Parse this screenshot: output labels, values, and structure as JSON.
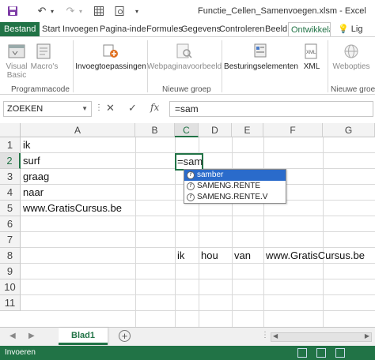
{
  "window": {
    "title": "Functie_Cellen_Samenvoegen.xlsm - Excel"
  },
  "tabs": [
    "Bestand",
    "Start",
    "Invoegen",
    "Pagina-inde",
    "Formules",
    "Gegevens",
    "Controleren",
    "Beeld",
    "Ontwikkelaa",
    "Vertel wat u wilt doen"
  ],
  "tell_me_label": "Lig",
  "ribbon": {
    "visual_basic": "Visual Basic",
    "macros": "Macro's",
    "invoegtoepassingen": "Invoegtoepassingen",
    "webpaginavoorbeeld": "Webpaginavoorbeeld",
    "besturingselementen": "Besturingselementen",
    "xml": "XML",
    "webopties": "Webopties",
    "group_programmacode": "Programmacode",
    "group_nieuwe_groep": "Nieuwe groep",
    "group_nieuwe_groep_2": "Nieuwe groep"
  },
  "formula_bar": {
    "name_box": "ZOEKEN",
    "cancel_symbol": "✕",
    "enter_symbol": "✓",
    "fx_symbol": "fx",
    "formula": "=sam"
  },
  "columns": [
    "A",
    "B",
    "C",
    "D",
    "E",
    "F",
    "G"
  ],
  "selected_column": "C",
  "rows": [
    "1",
    "2",
    "3",
    "4",
    "5",
    "6",
    "7",
    "8",
    "9",
    "10",
    "11"
  ],
  "selected_row": "2",
  "cells": {
    "A1": "ik",
    "A2": "surf",
    "A3": "graag",
    "A4": "naar",
    "A5": "www.GratisCursus.be",
    "C2": "=sam",
    "C8": "ik",
    "D8": "hou",
    "E8": "van",
    "F8": "www.GratisCursus.be"
  },
  "autocomplete": [
    "samber",
    "SAMENG.RENTE",
    "SAMENG.RENTE.V"
  ],
  "sheet_tabs": [
    "Blad1"
  ],
  "status": "Invoeren",
  "colors": {
    "excel_green": "#217346",
    "selection_blue": "#2a6bcb"
  }
}
